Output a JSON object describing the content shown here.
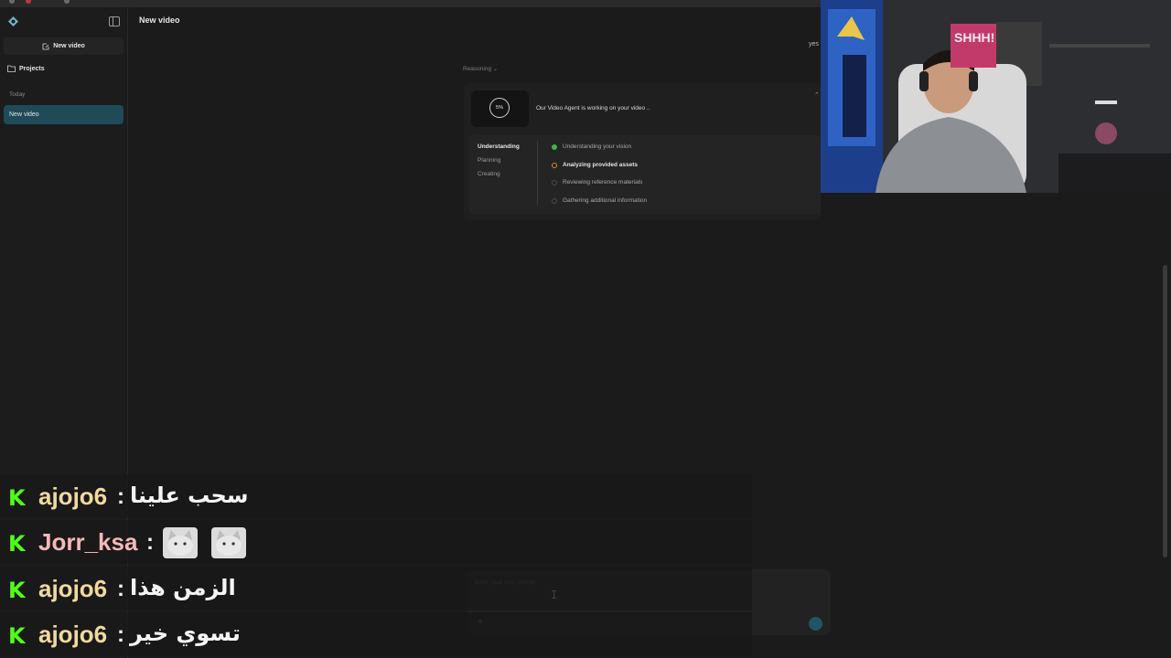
{
  "sidebar": {
    "new_video_label": "New video",
    "projects_label": "Projects",
    "section_today": "Today",
    "chat_items": [
      {
        "label": "New video"
      }
    ]
  },
  "header": {
    "title": "New video"
  },
  "conversation": {
    "user_message": "yes",
    "reasoning_label": "Reasoning",
    "agent": {
      "progress_text": "5%",
      "progress_fraction": 0.05,
      "status_text": "Our Video Agent is working on your video .."
    },
    "phases": [
      {
        "label": "Understanding",
        "active": true
      },
      {
        "label": "Planning",
        "active": false
      },
      {
        "label": "Creating",
        "active": false
      }
    ],
    "steps": [
      {
        "label": "Understanding your vision",
        "state": "done"
      },
      {
        "label": "Analyzing provided assets",
        "state": "running"
      },
      {
        "label": "Reviewing reference materials",
        "state": "pending"
      },
      {
        "label": "Gathering additional information",
        "state": "pending"
      }
    ]
  },
  "prompt": {
    "placeholder": "Enter your next prompt",
    "add_icon": "plus-icon",
    "send_icon": "send-icon"
  },
  "colors": {
    "accent": "#1f4a57",
    "step_done": "#3fb54a",
    "step_running": "#d98a2c",
    "chat_badge": "#53fc18"
  },
  "webcam": {
    "sign_text": "SHHH!"
  },
  "chat_overlay": {
    "separator": ":",
    "messages": [
      {
        "user": "ajojo6",
        "text": "سحب علينا",
        "emotes": []
      },
      {
        "user": "Jorr_ksa",
        "text": "",
        "emotes": [
          "cat-emote",
          "cat-emote"
        ]
      },
      {
        "user": "ajojo6",
        "text": "الزمن هذا",
        "emotes": []
      },
      {
        "user": "ajojo6",
        "text": "تسوي خير",
        "emotes": []
      }
    ]
  }
}
